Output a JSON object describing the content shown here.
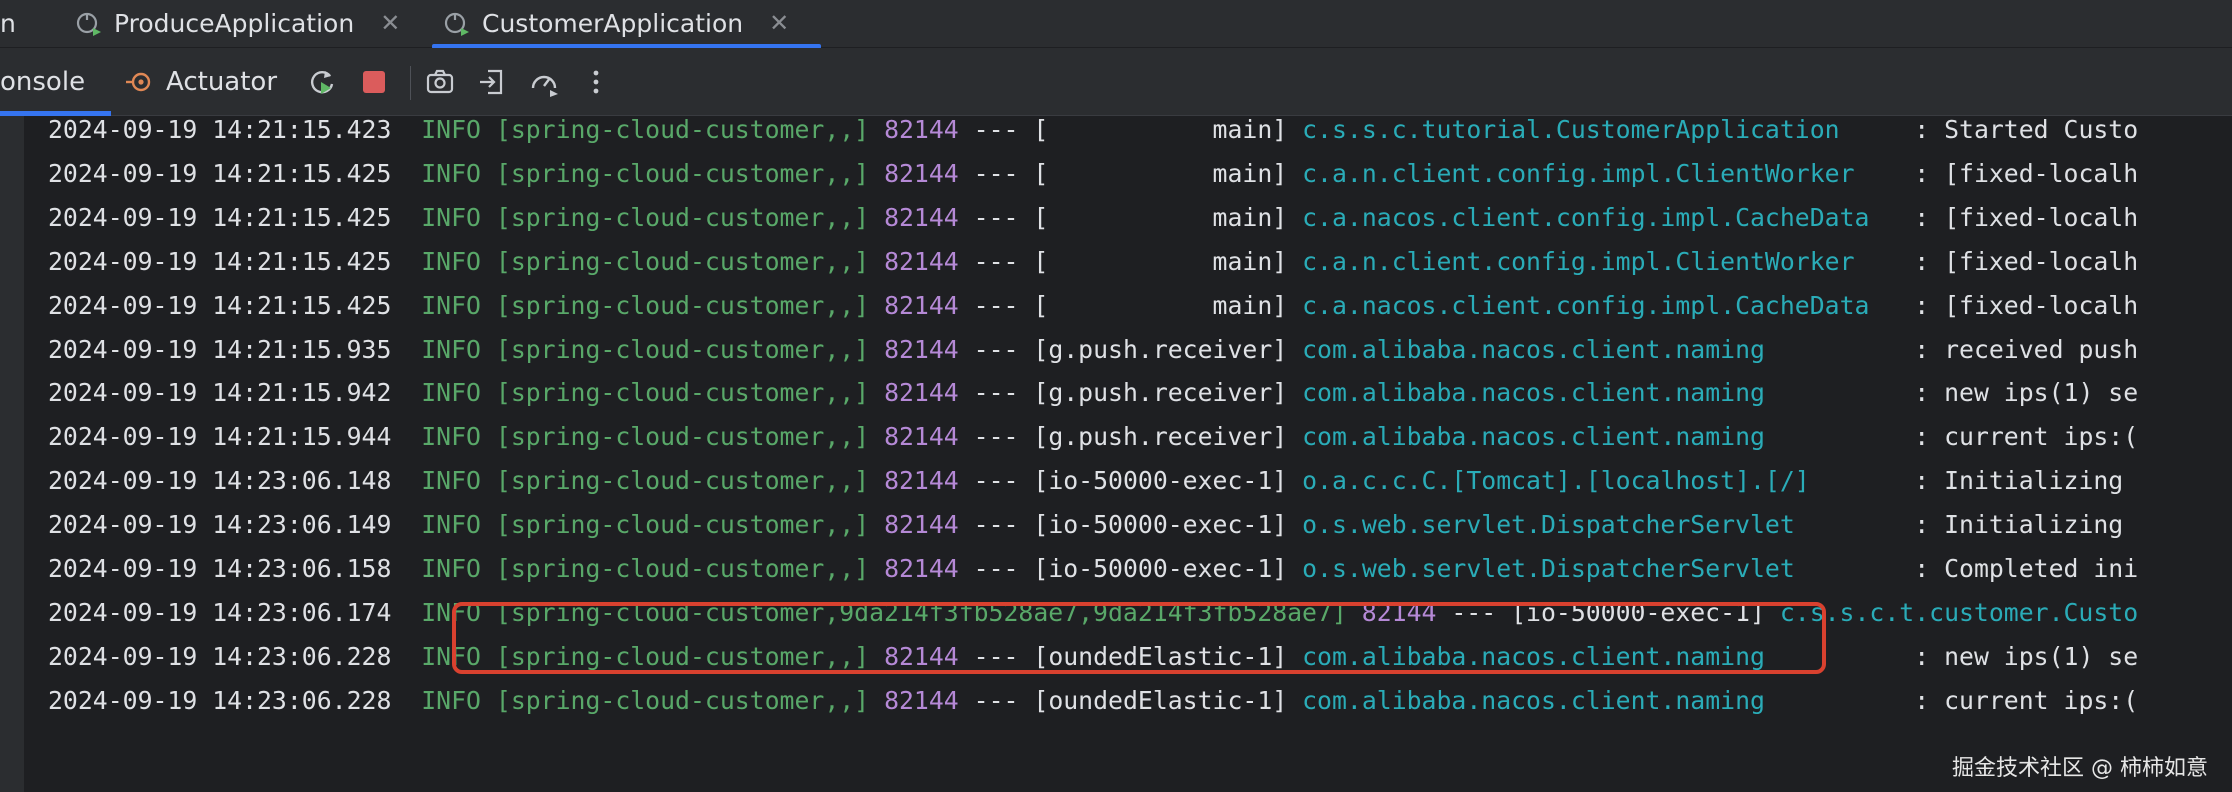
{
  "tabs": [
    {
      "label": "n",
      "active": false
    },
    {
      "label": "ProduceApplication",
      "active": false,
      "icon": "spring-boot-run-icon"
    },
    {
      "label": "CustomerApplication",
      "active": true,
      "icon": "spring-boot-run-icon"
    }
  ],
  "toolbar": {
    "console_label": "onsole",
    "actuator_label": "Actuator",
    "buttons": [
      "rerun-icon",
      "stop-icon",
      "screenshot-icon",
      "import-icon",
      "performance-icon",
      "more-icon"
    ]
  },
  "log_lines": [
    {
      "ts": "2024-09-19 14:21:15.423",
      "level": "INFO",
      "app": "[spring-cloud-customer,,]",
      "pid": "82144",
      "sep": "---",
      "thread": "[           main]",
      "logger": "c.s.s.c.tutorial.CustomerApplication    ",
      "msg": ": Started Custo"
    },
    {
      "ts": "2024-09-19 14:21:15.425",
      "level": "INFO",
      "app": "[spring-cloud-customer,,]",
      "pid": "82144",
      "sep": "---",
      "thread": "[           main]",
      "logger": "c.a.n.client.config.impl.ClientWorker   ",
      "msg": ": [fixed-localh"
    },
    {
      "ts": "2024-09-19 14:21:15.425",
      "level": "INFO",
      "app": "[spring-cloud-customer,,]",
      "pid": "82144",
      "sep": "---",
      "thread": "[           main]",
      "logger": "c.a.nacos.client.config.impl.CacheData  ",
      "msg": ": [fixed-localh"
    },
    {
      "ts": "2024-09-19 14:21:15.425",
      "level": "INFO",
      "app": "[spring-cloud-customer,,]",
      "pid": "82144",
      "sep": "---",
      "thread": "[           main]",
      "logger": "c.a.n.client.config.impl.ClientWorker   ",
      "msg": ": [fixed-localh"
    },
    {
      "ts": "2024-09-19 14:21:15.425",
      "level": "INFO",
      "app": "[spring-cloud-customer,,]",
      "pid": "82144",
      "sep": "---",
      "thread": "[           main]",
      "logger": "c.a.nacos.client.config.impl.CacheData  ",
      "msg": ": [fixed-localh"
    },
    {
      "ts": "2024-09-19 14:21:15.935",
      "level": "INFO",
      "app": "[spring-cloud-customer,,]",
      "pid": "82144",
      "sep": "---",
      "thread": "[g.push.receiver]",
      "logger": "com.alibaba.nacos.client.naming         ",
      "msg": ": received push"
    },
    {
      "ts": "2024-09-19 14:21:15.942",
      "level": "INFO",
      "app": "[spring-cloud-customer,,]",
      "pid": "82144",
      "sep": "---",
      "thread": "[g.push.receiver]",
      "logger": "com.alibaba.nacos.client.naming         ",
      "msg": ": new ips(1) se"
    },
    {
      "ts": "2024-09-19 14:21:15.944",
      "level": "INFO",
      "app": "[spring-cloud-customer,,]",
      "pid": "82144",
      "sep": "---",
      "thread": "[g.push.receiver]",
      "logger": "com.alibaba.nacos.client.naming         ",
      "msg": ": current ips:("
    },
    {
      "ts": "2024-09-19 14:23:06.148",
      "level": "INFO",
      "app": "[spring-cloud-customer,,]",
      "pid": "82144",
      "sep": "---",
      "thread": "[io-50000-exec-1]",
      "logger": "o.a.c.c.C.[Tomcat].[localhost].[/]      ",
      "msg": ": Initializing "
    },
    {
      "ts": "2024-09-19 14:23:06.149",
      "level": "INFO",
      "app": "[spring-cloud-customer,,]",
      "pid": "82144",
      "sep": "---",
      "thread": "[io-50000-exec-1]",
      "logger": "o.s.web.servlet.DispatcherServlet       ",
      "msg": ": Initializing "
    },
    {
      "ts": "2024-09-19 14:23:06.158",
      "level": "INFO",
      "app": "[spring-cloud-customer,,]",
      "pid": "82144",
      "sep": "---",
      "thread": "[io-50000-exec-1]",
      "logger": "o.s.web.servlet.DispatcherServlet       ",
      "msg": ": Completed ini"
    },
    {
      "ts": "2024-09-19 14:23:06.174",
      "level": "INFO",
      "app": "[spring-cloud-customer,9da214f3fb528ae7,9da214f3fb528ae7]",
      "pid": "82144",
      "sep": "---",
      "thread": "[io-50000-exec-1]",
      "logger": "c.s.s.c.t.customer.Custo",
      "msg": ""
    },
    {
      "ts": "2024-09-19 14:23:06.228",
      "level": "INFO",
      "app": "[spring-cloud-customer,,]",
      "pid": "82144",
      "sep": "---",
      "thread": "[oundedElastic-1]",
      "logger": "com.alibaba.nacos.client.naming         ",
      "msg": ": new ips(1) se"
    },
    {
      "ts": "2024-09-19 14:23:06.228",
      "level": "INFO",
      "app": "[spring-cloud-customer,,]",
      "pid": "82144",
      "sep": "---",
      "thread": "[oundedElastic-1]",
      "logger": "com.alibaba.nacos.client.naming         ",
      "msg": ": current ips:("
    }
  ],
  "watermark": "掘金技术社区 @ 柿柿如意",
  "colors": {
    "accent": "#3574f0",
    "highlight": "#d9412f",
    "info": "#59a869",
    "pid": "#b589d6",
    "logger": "#2aacb8"
  }
}
